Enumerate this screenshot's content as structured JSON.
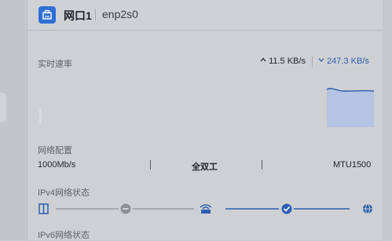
{
  "port": {
    "name": "网口1",
    "interface": "enp2s0",
    "icon": "ethernet-port-icon"
  },
  "speed": {
    "label": "实时速率",
    "upload": "11.5 KB/s",
    "download": "247.3 KB/s",
    "upload_icon": "arrow-up-icon",
    "download_icon": "arrow-down-icon"
  },
  "network": {
    "label": "网络配置",
    "rate": "1000Mb/s",
    "duplex": "全双工",
    "mtu": "MTU1500"
  },
  "ipv4": {
    "label": "IPv4网络状态",
    "nodes": [
      "device-icon",
      "disconnected-icon",
      "router-icon",
      "connected-check-icon",
      "internet-globe-icon"
    ]
  },
  "ipv6": {
    "label": "IPv6网络状态"
  },
  "colors": {
    "accent": "#2f6fd6",
    "download": "#2b5fb0",
    "chart_fill": "#b4c4e2"
  }
}
